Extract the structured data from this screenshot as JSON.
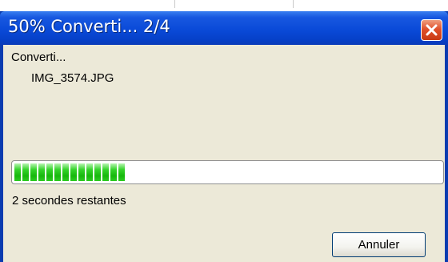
{
  "window": {
    "title": "50% Converti...  2/4",
    "close_icon": "close-icon",
    "accent_color": "#0a4ad8",
    "close_color": "#e0502a"
  },
  "dialog": {
    "status_label": "Converti...",
    "file_name": "IMG_3574.JPG",
    "time_remaining": "2 secondes restantes",
    "progress_fraction": 0.27,
    "progress_color": "#22c318",
    "cancel_label": "Annuler"
  }
}
